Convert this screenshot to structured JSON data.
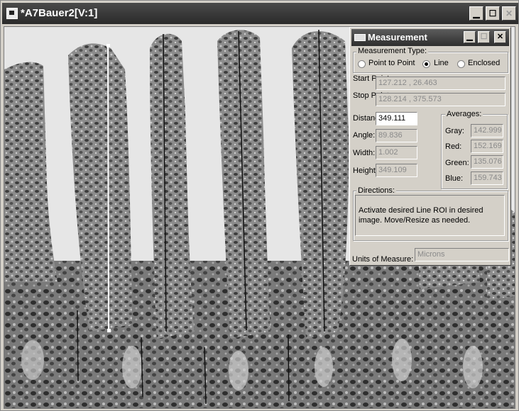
{
  "window": {
    "title": "*A7Bauer2[V:1]",
    "controls": {
      "minimize": "▁",
      "maximize": "☐",
      "close": "✕"
    }
  },
  "image_view": {
    "icon": "microscopy-image",
    "roi_line_color": "#ffffff"
  },
  "measurement": {
    "title": "Measurement",
    "controls": {
      "minimize": "▁",
      "maximize": "☐",
      "close": "✕"
    },
    "type_group_label": "Measurement Type:",
    "types": [
      {
        "label": "Point to Point",
        "selected": false
      },
      {
        "label": "Line",
        "selected": true
      },
      {
        "label": "Enclosed",
        "selected": false
      }
    ],
    "start_label": "Start Point:",
    "start_value": "127.212 , 26.463",
    "stop_label": "Stop Point:",
    "stop_value": "128.214 , 375.573",
    "distance_label": "Distance:",
    "distance_value": "349.111",
    "angle_label": "Angle:",
    "angle_value": "89.836",
    "width_label": "Width:",
    "width_value": "1.002",
    "height_label": "Height:",
    "height_value": "349.109",
    "averages_label": "Averages:",
    "gray_label": "Gray:",
    "gray_value": "142.999",
    "red_label": "Red:",
    "red_value": "152.169",
    "green_label": "Green:",
    "green_value": "135.076",
    "blue_label": "Blue:",
    "blue_value": "159.743",
    "directions_label": "Directions:",
    "directions_text": "Activate desired Line ROI in desired image. Move/Resize as needed.",
    "units_label": "Units of Measure:",
    "units_value": "Microns"
  }
}
